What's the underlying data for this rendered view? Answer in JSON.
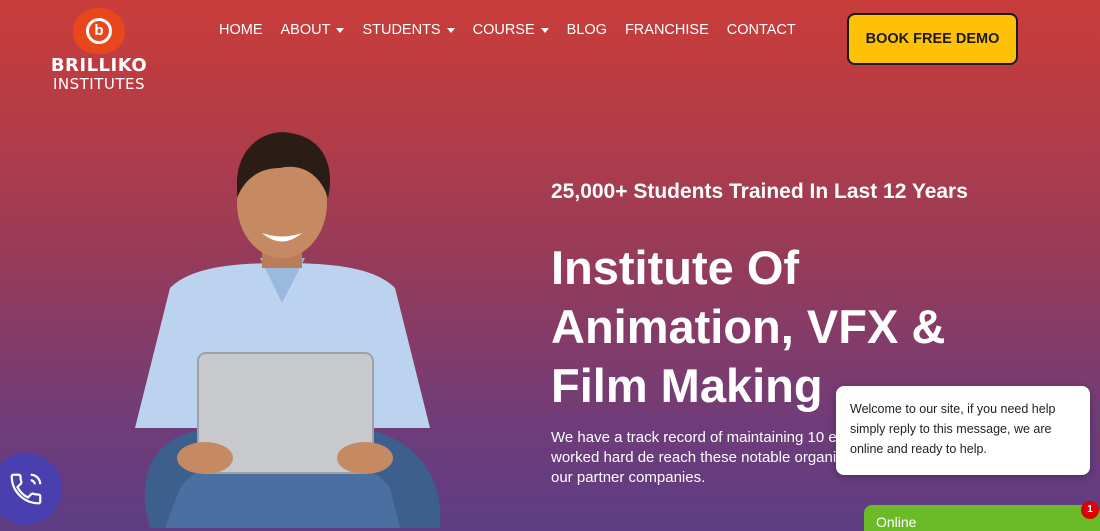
{
  "brand": {
    "name": "BRILLIKO",
    "sub": "INSTITUTES"
  },
  "nav": {
    "items": [
      {
        "label": "HOME",
        "dropdown": false
      },
      {
        "label": "ABOUT",
        "dropdown": true
      },
      {
        "label": "STUDENTS",
        "dropdown": true
      },
      {
        "label": "COURSE",
        "dropdown": true
      },
      {
        "label": "BLOG",
        "dropdown": false
      },
      {
        "label": "FRANCHISE",
        "dropdown": false
      },
      {
        "label": "CONTACT",
        "dropdown": false
      }
    ]
  },
  "cta": {
    "label": "BOOK FREE DEMO"
  },
  "hero": {
    "tagline": "25,000+ Students Trained In Last 12 Years",
    "headline": "Institute Of Animation, VFX & Film Making",
    "paragraph": "We have a track record of maintaining 10 every batch. Brilliko have worked hard de reach these notable organizations, most of which are our partner companies."
  },
  "chat": {
    "message": "Welcome to our site, if you need help simply reply to this message, we are online and ready to help.",
    "status": "Online",
    "unread_count": "1"
  },
  "colors": {
    "accent": "#ffc107",
    "brand": "#e8471c",
    "online": "#6bba27"
  }
}
